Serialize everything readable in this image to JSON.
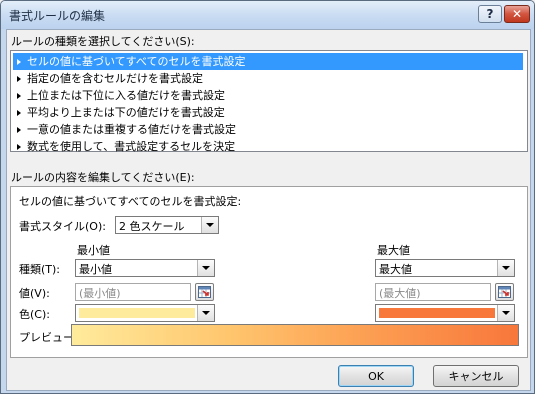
{
  "window": {
    "title": "書式ルールの編集",
    "help_glyph": "?",
    "close_glyph": "✕"
  },
  "rule_type": {
    "label": "ルールの種類を選択してください(S):",
    "items": [
      "セルの値に基づいてすべてのセルを書式設定",
      "指定の値を含むセルだけを書式設定",
      "上位または下位に入る値だけを書式設定",
      "平均より上または下の値だけを書式設定",
      "一意の値または重複する値だけを書式設定",
      "数式を使用して、書式設定するセルを決定"
    ],
    "selected_index": 0
  },
  "rule_content": {
    "label": "ルールの内容を編集してください(E):",
    "description": "セルの値に基づいてすべてのセルを書式設定:",
    "format_style_label": "書式スタイル(O):",
    "format_style_value": "2 色スケール",
    "type_label": "種類(T):",
    "value_label": "値(V):",
    "color_label": "色(C):",
    "min": {
      "header": "最小値",
      "type_value": "最小値",
      "value_placeholder": "(最小値)",
      "color": "#ffeb9c"
    },
    "max": {
      "header": "最大値",
      "type_value": "最大値",
      "value_placeholder": "(最大値)",
      "color": "#f8773b"
    },
    "preview_label": "プレビュー:",
    "preview_gradient": [
      "#ffeb9c",
      "#f8773b"
    ]
  },
  "buttons": {
    "ok": "OK",
    "cancel": "キャンセル"
  },
  "accent": {
    "selection": "#3399ff"
  }
}
